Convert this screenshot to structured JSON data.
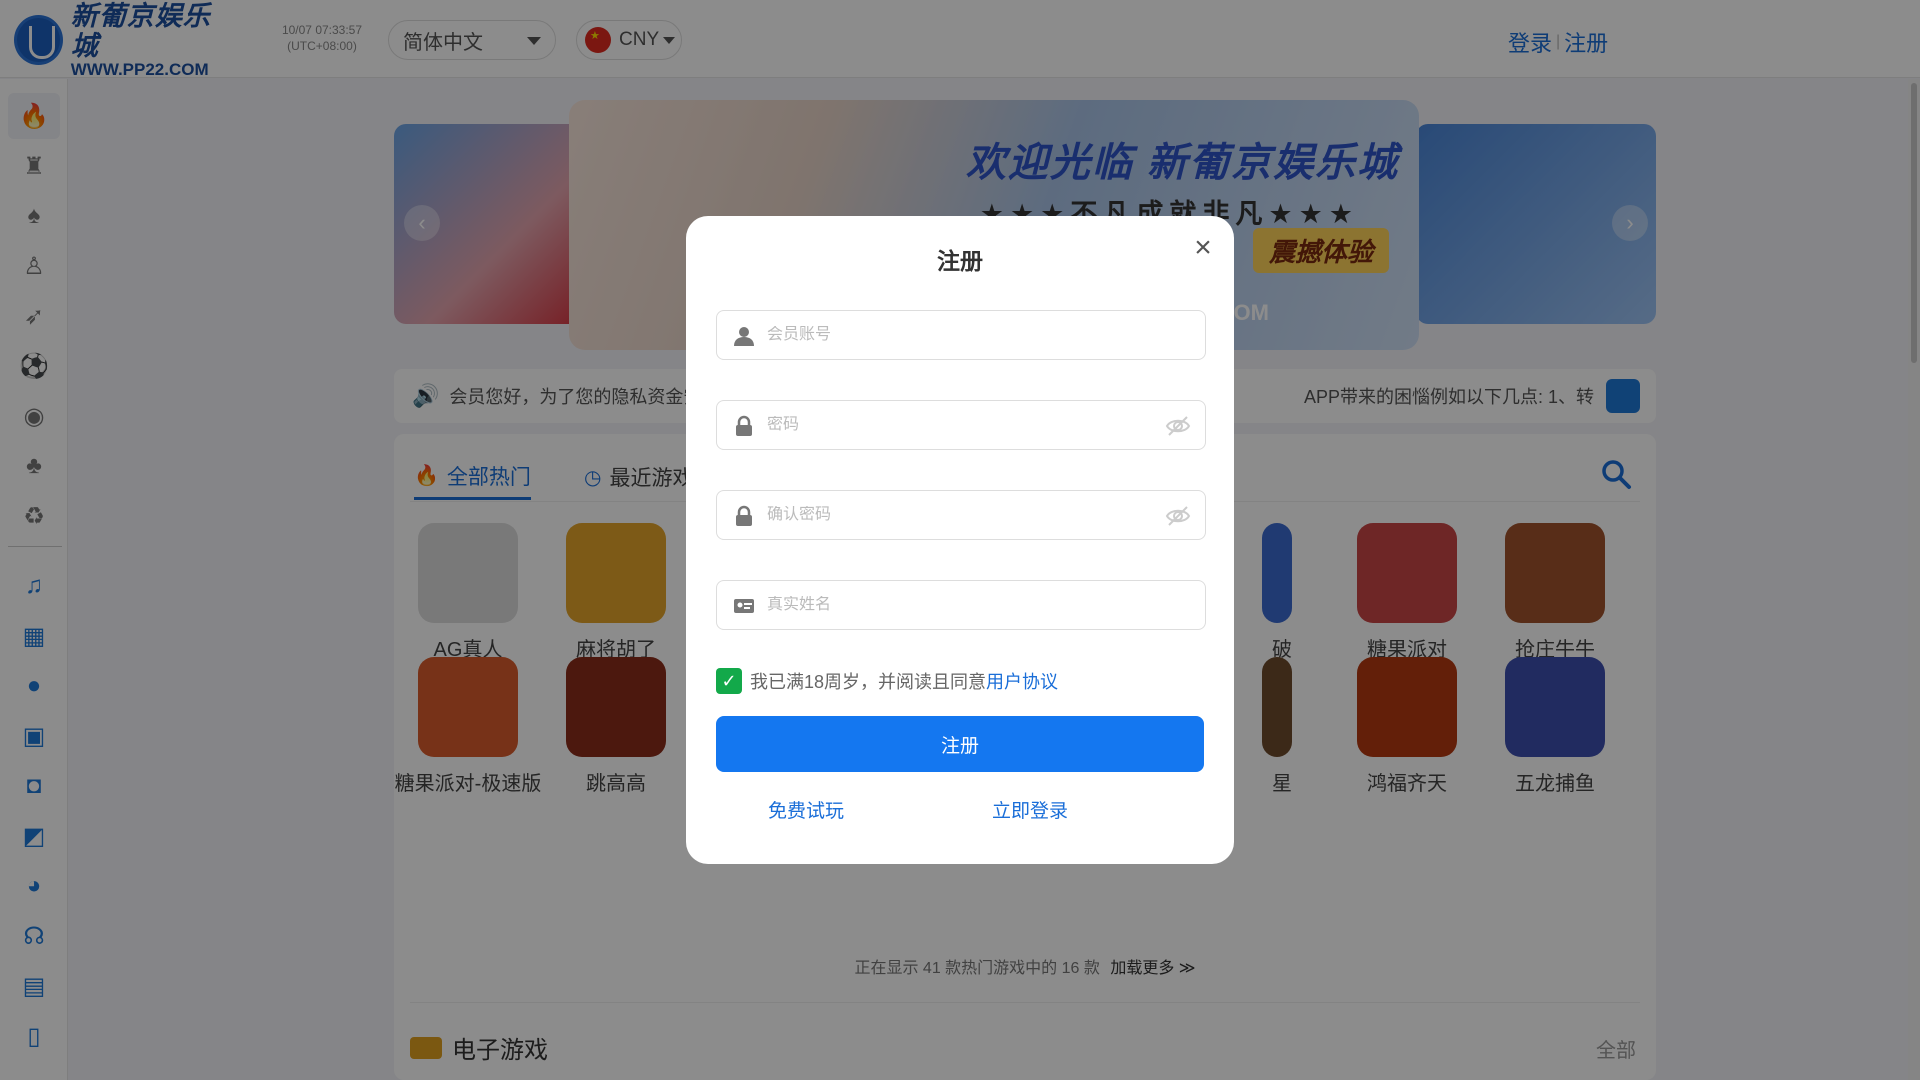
{
  "header": {
    "logo_cn": "新葡京娱乐城",
    "logo_en": "WWW.PP22.COM",
    "clock_time": "10/07 07:33:57",
    "clock_tz": "(UTC+08:00)",
    "language": "简体中文",
    "currency": "CNY",
    "login_label": "登录",
    "register_label": "注册"
  },
  "sidebar": {
    "items": [
      {
        "name": "hot",
        "icon": "flame-icon"
      },
      {
        "name": "slots",
        "icon": "slot-777-icon"
      },
      {
        "name": "cards",
        "icon": "cards-icon"
      },
      {
        "name": "live",
        "icon": "dealer-icon"
      },
      {
        "name": "fishing",
        "icon": "fish-icon"
      },
      {
        "name": "sports",
        "icon": "soccer-icon"
      },
      {
        "name": "esports",
        "icon": "gamepad-icon"
      },
      {
        "name": "lottery",
        "icon": "tree-icon"
      },
      {
        "name": "chess",
        "icon": "recycle-icon"
      },
      {
        "name": "music",
        "icon": "music-icon"
      },
      {
        "name": "gift",
        "icon": "gift-icon"
      },
      {
        "name": "bag",
        "icon": "moneybag-icon"
      },
      {
        "name": "promo",
        "icon": "present-icon"
      },
      {
        "name": "vip",
        "icon": "shield-icon"
      },
      {
        "name": "trend",
        "icon": "trend-icon"
      },
      {
        "name": "savings",
        "icon": "piggy-icon"
      },
      {
        "name": "support",
        "icon": "headset-icon"
      },
      {
        "name": "records",
        "icon": "document-icon"
      },
      {
        "name": "app",
        "icon": "phone-icon"
      }
    ]
  },
  "banner": {
    "title": "欢迎光临 新葡京娱乐城",
    "subtitle": "★★★不凡成就非凡★★★",
    "tag": "震撼体验",
    "fragment": "COM",
    "prev": "‹",
    "next": "›"
  },
  "notice": {
    "left_text": "会员您好，为了您的隐私资金安",
    "right_text": "APP带来的困惱例如以下几点: 1、转"
  },
  "tabs": [
    {
      "label": "全部热门",
      "active": true
    },
    {
      "label": "最近游戏",
      "active": false
    }
  ],
  "games_row1": [
    {
      "name": "AG真人",
      "color": "#dcdcdc"
    },
    {
      "name": "麻将胡了",
      "color": "#e3a52b"
    },
    {
      "name": "破",
      "color": "#3b6bd0"
    },
    {
      "name": "糖果派对",
      "color": "#c94545"
    },
    {
      "name": "抢庄牛牛",
      "color": "#a0522d"
    }
  ],
  "games_row2": [
    {
      "name": "糖果派对-极速版",
      "color": "#d95c2c"
    },
    {
      "name": "跳高高",
      "color": "#8b2c1a"
    },
    {
      "name": "星",
      "color": "#6d4b2c"
    },
    {
      "name": "鸿福齐天",
      "color": "#b53a12"
    },
    {
      "name": "五龙捕鱼",
      "color": "#3d4fb0"
    }
  ],
  "load_more": {
    "text": "正在显示 41 款热门游戏中的 16 款",
    "action": "加载更多 ≫"
  },
  "section": {
    "title": "电子游戏",
    "all_label": "全部"
  },
  "modal": {
    "title": "注册",
    "close": "×",
    "account_placeholder": "会员账号",
    "password_placeholder": "密码",
    "confirm_placeholder": "确认密码",
    "realname_placeholder": "真实姓名",
    "agree_text": "我已满18周岁，并阅读且同意",
    "agree_link": "用户协议",
    "agree_checked": true,
    "submit_label": "注册",
    "trial_label": "免费试玩",
    "login_now_label": "立即登录"
  }
}
